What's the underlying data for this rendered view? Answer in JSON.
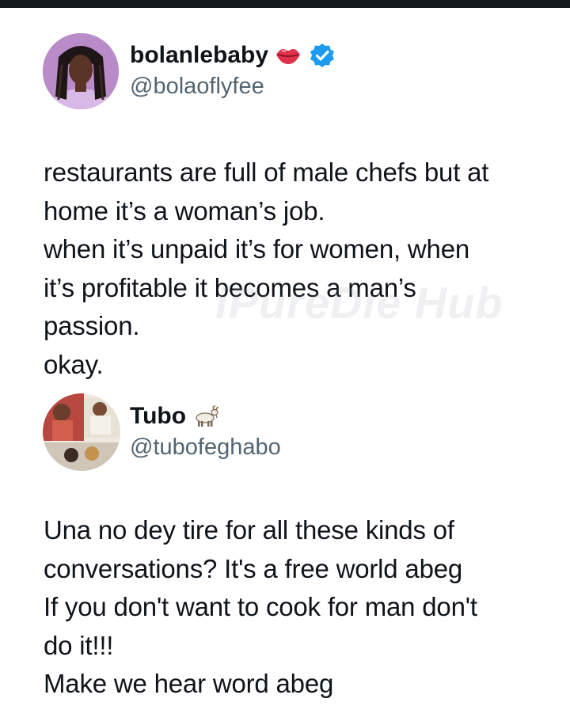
{
  "tweet": {
    "display_name": "bolanlebaby",
    "handle": "@bolaoflyfee",
    "lines": [
      "restaurants are full of male chefs but at",
      "home it’s a woman’s job.",
      "when it’s unpaid it’s for women, when",
      "it’s profitable it becomes a man’s",
      "passion.",
      "okay."
    ],
    "icons": [
      "kiss-lips-icon",
      "verified-badge-icon"
    ],
    "verified_color": "#1d9bf0"
  },
  "reply": {
    "display_name": "Tubo",
    "handle": "@tubofeghabo",
    "lines": [
      "Una no dey tire for all these kinds of",
      "conversations? It's a free world abeg",
      "If you don't want to cook for man don't",
      "do it!!!",
      "Make we hear word abeg"
    ],
    "icons": [
      "goat-icon"
    ]
  },
  "watermark": "iPureDie Hub"
}
